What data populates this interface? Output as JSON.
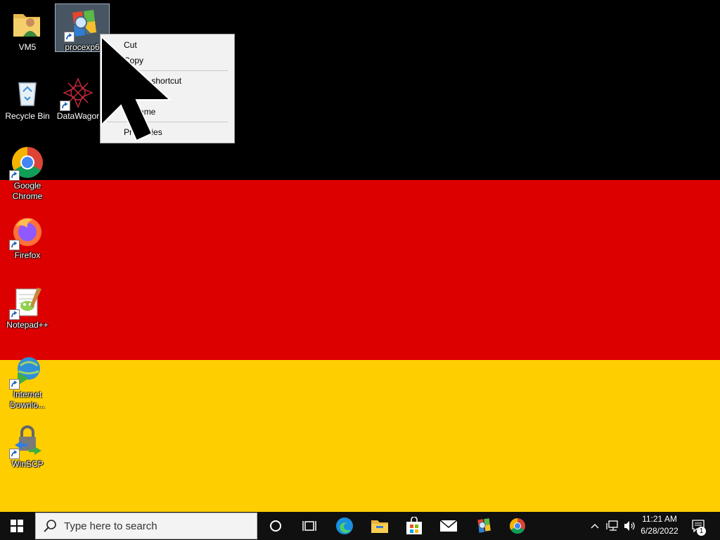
{
  "desktop": {
    "flag_colors": {
      "black": "#000000",
      "red": "#dd0000",
      "gold": "#ffce00"
    },
    "icons": [
      {
        "label": "VM5",
        "icon": "folder-user-icon"
      },
      {
        "label": "procexp6",
        "icon": "process-explorer-icon",
        "selected": true
      },
      {
        "label": "Recycle Bin",
        "icon": "recycle-bin-icon"
      },
      {
        "label": "DataWagor",
        "icon": "datawagor-icon"
      },
      {
        "label": "Google Chrome",
        "icon": "chrome-icon"
      },
      {
        "label": "Firefox",
        "icon": "firefox-icon"
      },
      {
        "label": "Notepad++",
        "icon": "notepadpp-icon"
      },
      {
        "label": "Internet Downlo...",
        "icon": "idm-icon"
      },
      {
        "label": "WinSCP",
        "icon": "winscp-icon"
      }
    ]
  },
  "context_menu": {
    "items": [
      {
        "label": "Cut"
      },
      {
        "label": "Copy"
      },
      {
        "label": "Create shortcut"
      },
      {
        "label": "Delete"
      },
      {
        "label": "Rename"
      },
      {
        "label": "Properties"
      }
    ]
  },
  "taskbar": {
    "start_icon": "windows-logo-icon",
    "search_placeholder": "Type here to search",
    "pinned": [
      "cortana-icon",
      "task-view-icon",
      "edge-icon",
      "file-explorer-icon",
      "store-icon",
      "mail-icon",
      "process-explorer-icon",
      "chrome-icon"
    ],
    "tray": {
      "time": "11:21 AM",
      "date": "6/28/2022",
      "notification_count": "1"
    }
  }
}
